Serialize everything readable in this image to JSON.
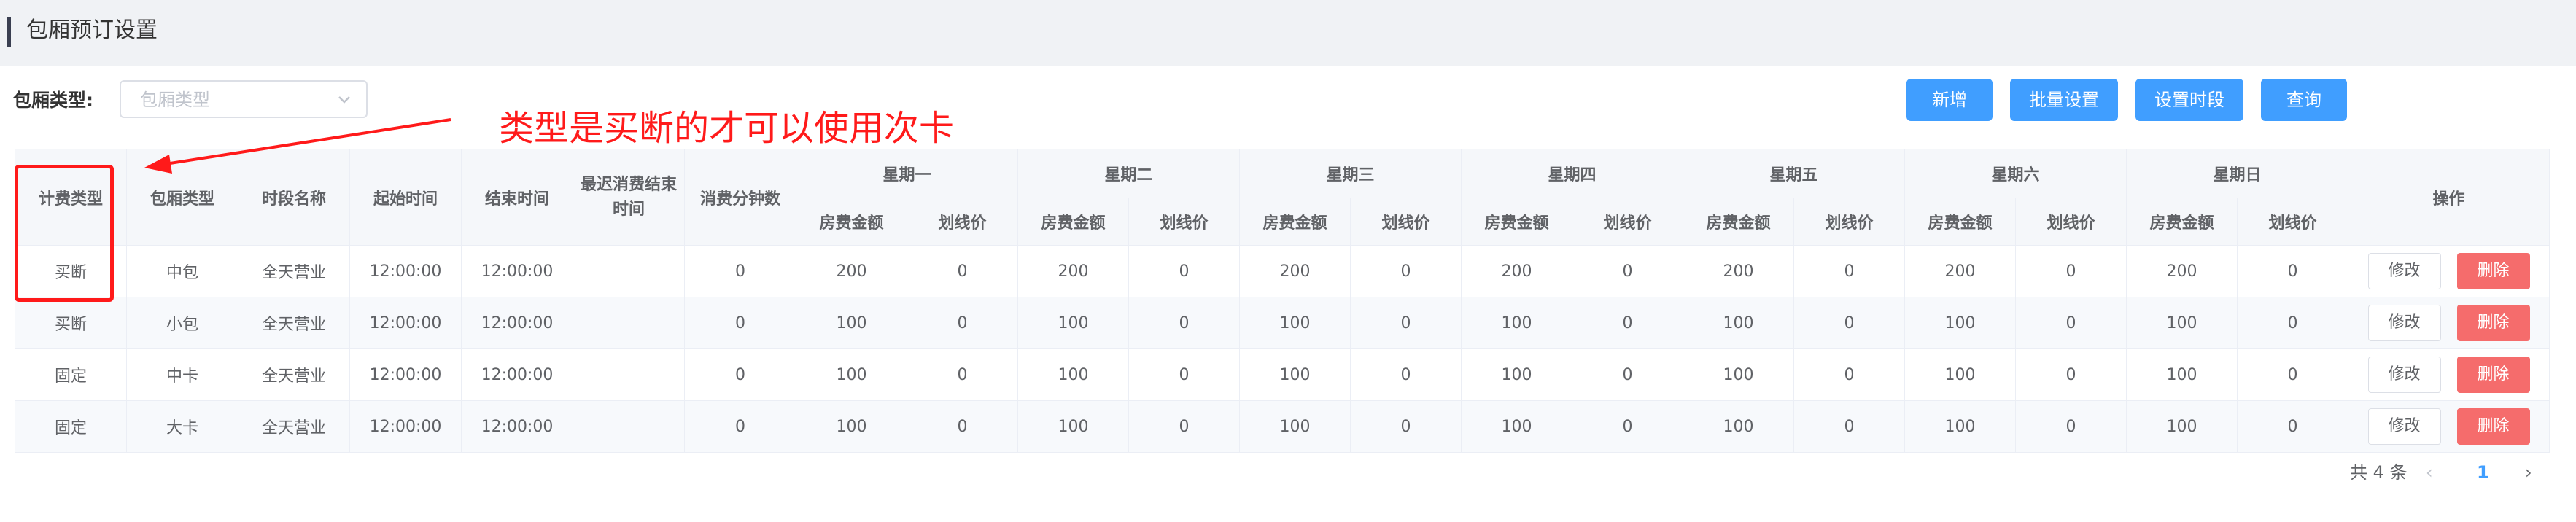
{
  "header": {
    "title": "包厢预订设置"
  },
  "filter": {
    "label": "包厢类型:",
    "placeholder": "包厢类型"
  },
  "toolbar": {
    "buttons": [
      {
        "label": "新增"
      },
      {
        "label": "批量设置"
      },
      {
        "label": "设置时段"
      },
      {
        "label": "查询"
      }
    ]
  },
  "annotation": {
    "text": "类型是买断的才可以使用次卡",
    "color": "#ff1a1a"
  },
  "table": {
    "columns": {
      "billing_type": "计费类型",
      "room_type": "包厢类型",
      "period_name": "时段名称",
      "start_time": "起始时间",
      "end_time": "结束时间",
      "last_end_time": "最迟消费结束时间",
      "minutes": "消费分钟数",
      "operations": "操作"
    },
    "days": [
      "星期一",
      "星期二",
      "星期三",
      "星期四",
      "星期五",
      "星期六",
      "星期日"
    ],
    "sub_cols": {
      "fee": "房费金额",
      "strike": "划线价"
    },
    "rows": [
      {
        "billing_type": "买断",
        "room_type": "中包",
        "period_name": "全天营业",
        "start_time": "12:00:00",
        "end_time": "12:00:00",
        "last_end_time": "",
        "minutes": "0",
        "day_values": [
          [
            "200",
            "0"
          ],
          [
            "200",
            "0"
          ],
          [
            "200",
            "0"
          ],
          [
            "200",
            "0"
          ],
          [
            "200",
            "0"
          ],
          [
            "200",
            "0"
          ],
          [
            "200",
            "0"
          ]
        ]
      },
      {
        "billing_type": "买断",
        "room_type": "小包",
        "period_name": "全天营业",
        "start_time": "12:00:00",
        "end_time": "12:00:00",
        "last_end_time": "",
        "minutes": "0",
        "day_values": [
          [
            "100",
            "0"
          ],
          [
            "100",
            "0"
          ],
          [
            "100",
            "0"
          ],
          [
            "100",
            "0"
          ],
          [
            "100",
            "0"
          ],
          [
            "100",
            "0"
          ],
          [
            "100",
            "0"
          ]
        ]
      },
      {
        "billing_type": "固定",
        "room_type": "中卡",
        "period_name": "全天营业",
        "start_time": "12:00:00",
        "end_time": "12:00:00",
        "last_end_time": "",
        "minutes": "0",
        "day_values": [
          [
            "100",
            "0"
          ],
          [
            "100",
            "0"
          ],
          [
            "100",
            "0"
          ],
          [
            "100",
            "0"
          ],
          [
            "100",
            "0"
          ],
          [
            "100",
            "0"
          ],
          [
            "100",
            "0"
          ]
        ]
      },
      {
        "billing_type": "固定",
        "room_type": "大卡",
        "period_name": "全天营业",
        "start_time": "12:00:00",
        "end_time": "12:00:00",
        "last_end_time": "",
        "minutes": "0",
        "day_values": [
          [
            "100",
            "0"
          ],
          [
            "100",
            "0"
          ],
          [
            "100",
            "0"
          ],
          [
            "100",
            "0"
          ],
          [
            "100",
            "0"
          ],
          [
            "100",
            "0"
          ],
          [
            "100",
            "0"
          ]
        ]
      }
    ],
    "row_actions": {
      "edit": "修改",
      "delete": "删除"
    }
  },
  "pagination": {
    "total": "共 4 条",
    "prev": "‹",
    "current": "1",
    "next": "›"
  },
  "colors": {
    "primary": "#409eff",
    "danger": "#f56c6c",
    "header_bg": "#f5f7fa",
    "title_bg": "#f0f2f5"
  }
}
